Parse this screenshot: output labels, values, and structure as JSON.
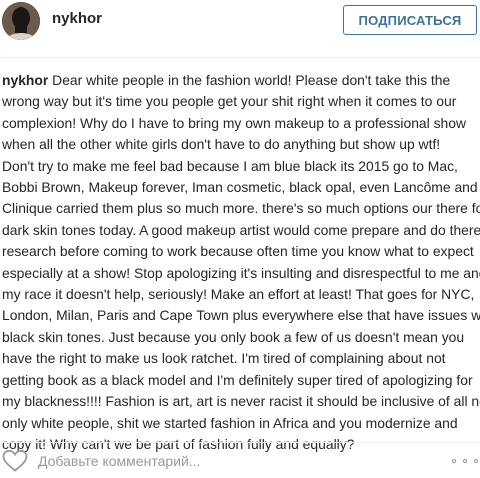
{
  "header": {
    "username": "nykhor",
    "follow_label": "ПОДПИСАТЬСЯ"
  },
  "caption": {
    "author": "nykhor",
    "lines": [
      "Dear white people in the fashion world! Please don't take this the",
      "wrong way but it's time you people get your shit right when it comes to our",
      "complexion! Why do I have to bring my own makeup to a professional show",
      "when all the other white girls don't have to do anything but show up wtf!",
      "Don't try to make me feel bad because I am blue black its 2015 go to Mac,",
      "Bobbi Brown, Makeup forever, Iman cosmetic, black opal, even Lancôme and",
      "Clinique carried them plus so much more. there's so much options our there for",
      "dark skin tones today. A good makeup artist would come prepare and do there",
      "research before coming to work because often time you know what to expect",
      "especially at a show! Stop apologizing it's insulting and disrespectful to me and",
      "my race it doesn't help, seriously! Make an effort at least! That goes for NYC,",
      "London, Milan, Paris and Cape Town plus everywhere else that have issues with",
      "black skin tones. Just because you only book a few of us doesn't mean you",
      "have the right to make us look ratchet. I'm tired of complaining about not",
      "getting book as a black model and I'm definitely super tired of apologizing for",
      "my blackness!!!! Fashion is art, art is never racist it should be inclusive of all not",
      "only white people, shit we started fashion in Africa and you modernize and",
      "copy it! Why can't we be part of fashion fully and equally?"
    ]
  },
  "footer": {
    "comment_placeholder": "Добавьте комментарий...",
    "like_icon": "heart-outline-icon",
    "more_icon": "more-options-icon"
  },
  "colors": {
    "accent": "#3f729b",
    "text": "#262626",
    "muted": "#999999",
    "divider": "#efefef"
  }
}
